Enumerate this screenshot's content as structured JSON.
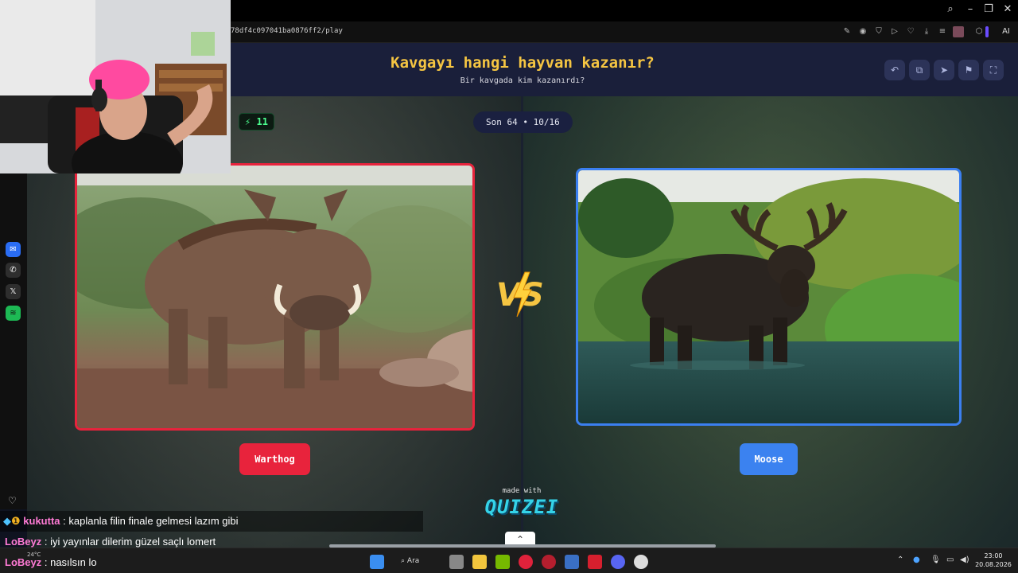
{
  "browser": {
    "url": "78df4c097041ba0876ff2/play",
    "ai_label": "AI"
  },
  "game": {
    "title": "Kavgayı hangi hayvan kazanır?",
    "subtitle": "Bir kavgada kim kazanırdı?",
    "streak": "11",
    "round_label": "Son 64 • 10/16",
    "left_option": "Warthog",
    "right_option": "Moose",
    "made_with": "made with",
    "brand": "QUIZEI",
    "left_border_color": "#e8233c",
    "right_border_color": "#3b7ff0"
  },
  "chat": [
    {
      "user": "kukutta",
      "message": ": kaplanla filin finale gelmesi lazım gibi",
      "color": "#ff7bd5"
    },
    {
      "user": "LoBeyz",
      "message": ": iyi yayınlar dilerim güzel saçlı lomert",
      "color": "#ff7bd5"
    },
    {
      "user": "LoBeyz",
      "message": ": nasılsın lo",
      "color": "#ff7bd5"
    }
  ],
  "taskbar": {
    "search_label": "Ara",
    "weather": "24°C",
    "time": "23:00",
    "date": "20.08.2026"
  }
}
